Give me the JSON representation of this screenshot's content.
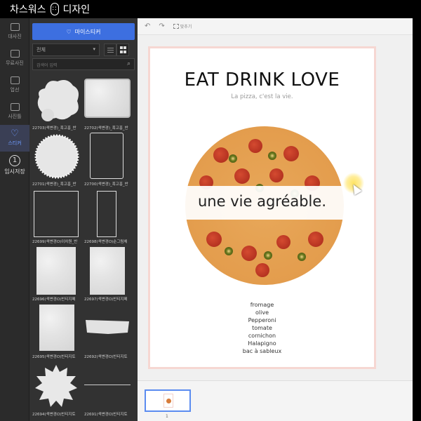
{
  "titlebar": {
    "brand_left": "차스워스",
    "logo_glyph": "",
    "brand_right": "디자인"
  },
  "rail": {
    "items": [
      {
        "label": "대사진",
        "icon": "photo-icon"
      },
      {
        "label": "무료사진",
        "icon": "free-photo-icon"
      },
      {
        "label": "업선",
        "icon": "upload-icon"
      },
      {
        "label": "사진틀",
        "icon": "frame-icon"
      },
      {
        "label": "스티커",
        "icon": "heart-icon"
      },
      {
        "label": "임시저장",
        "icon": "number-one-icon",
        "glyph": "1"
      }
    ]
  },
  "panel": {
    "my_sticker_label": "마이스티커",
    "filter_value": "전체",
    "search_placeholder": "검색어 입력",
    "tiles": [
      {
        "label": "22703(색변경)_흑고흥_반"
      },
      {
        "label": "22702(색변경)_흑고흥_반"
      },
      {
        "label": "22701(색변경)_흑고흥_반"
      },
      {
        "label": "22700(색변경)_흑고흥_반"
      },
      {
        "label": "22699(색변경O)이차원_반"
      },
      {
        "label": "22698(색변경O)순그림체"
      },
      {
        "label": "22696(색변경O)빈티지페"
      },
      {
        "label": "22697(색변경O)빈티지페"
      },
      {
        "label": "22695(색변경O)빈티지토"
      },
      {
        "label": "22692(색변경O)빈티지토"
      },
      {
        "label": "22694(색변경O)빈티지토"
      },
      {
        "label": "22691(색변경O)빈티지토"
      }
    ]
  },
  "toolbar": {
    "undo": "↶",
    "redo": "↷",
    "fit_label": "맞추기"
  },
  "poster": {
    "title": "EAT DRINK LOVE",
    "subtitle": "La pizza, c'est la vie.",
    "banner": "une vie agréable.",
    "ingredients": [
      "fromage",
      "olive",
      "Pepperoni",
      "tomate",
      "cornichon",
      "Halapigno",
      "bac à sableux"
    ]
  },
  "pages": {
    "current_number": "1"
  },
  "colors": {
    "accent": "#3d6fe0",
    "panel": "#323232",
    "rail": "#2b2b2b",
    "page_border": "#f6d7d2"
  }
}
